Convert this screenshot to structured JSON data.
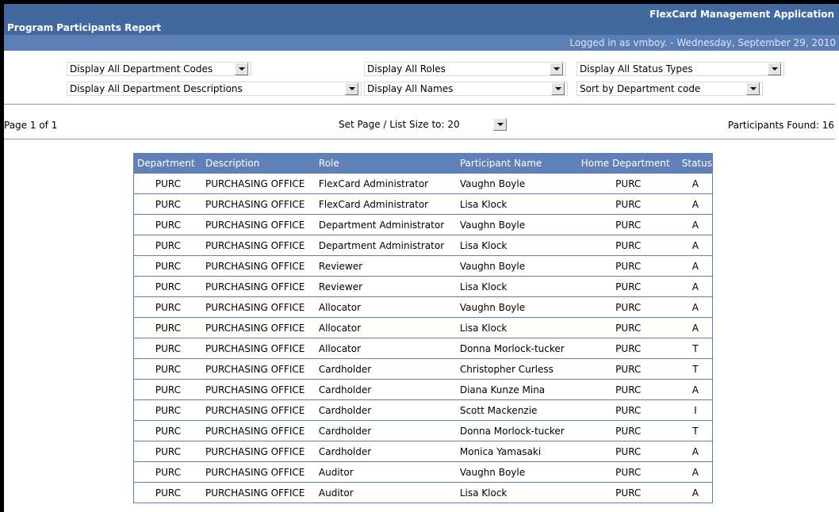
{
  "header": {
    "report_title": "Program Participants Report",
    "app_title": "FlexCard Management Application",
    "login_status": "Logged in as vmboy. - Wednesday, September 29, 2010"
  },
  "filters": {
    "dept_codes": "Display All Department Codes",
    "dept_descriptions": "Display All Department Descriptions",
    "roles": "Display All Roles",
    "names": "Display All Names",
    "status_types": "Display All Status Types",
    "sort": "Sort by Department code"
  },
  "pager": {
    "page_info": "Page 1 of 1",
    "page_size": "Set Page / List Size to: 20",
    "found": "Participants Found: 16"
  },
  "table": {
    "columns": [
      "Department",
      "Description",
      "Role",
      "Participant Name",
      "Home Department",
      "Status"
    ],
    "rows": [
      [
        "PURC",
        "PURCHASING OFFICE",
        "FlexCard Administrator",
        "Vaughn Boyle",
        "PURC",
        "A"
      ],
      [
        "PURC",
        "PURCHASING OFFICE",
        "FlexCard Administrator",
        "Lisa Klock",
        "PURC",
        "A"
      ],
      [
        "PURC",
        "PURCHASING OFFICE",
        "Department Administrator",
        "Vaughn Boyle",
        "PURC",
        "A"
      ],
      [
        "PURC",
        "PURCHASING OFFICE",
        "Department Administrator",
        "Lisa Klock",
        "PURC",
        "A"
      ],
      [
        "PURC",
        "PURCHASING OFFICE",
        "Reviewer",
        "Vaughn Boyle",
        "PURC",
        "A"
      ],
      [
        "PURC",
        "PURCHASING OFFICE",
        "Reviewer",
        "Lisa Klock",
        "PURC",
        "A"
      ],
      [
        "PURC",
        "PURCHASING OFFICE",
        "Allocator",
        "Vaughn Boyle",
        "PURC",
        "A"
      ],
      [
        "PURC",
        "PURCHASING OFFICE",
        "Allocator",
        "Lisa Klock",
        "PURC",
        "A"
      ],
      [
        "PURC",
        "PURCHASING OFFICE",
        "Allocator",
        "Donna Morlock-tucker",
        "PURC",
        "T"
      ],
      [
        "PURC",
        "PURCHASING OFFICE",
        "Cardholder",
        "Christopher Curless",
        "PURC",
        "T"
      ],
      [
        "PURC",
        "PURCHASING OFFICE",
        "Cardholder",
        "Diana Kunze Mina",
        "PURC",
        "A"
      ],
      [
        "PURC",
        "PURCHASING OFFICE",
        "Cardholder",
        "Scott Mackenzie",
        "PURC",
        "I"
      ],
      [
        "PURC",
        "PURCHASING OFFICE",
        "Cardholder",
        "Donna Morlock-tucker",
        "PURC",
        "T"
      ],
      [
        "PURC",
        "PURCHASING OFFICE",
        "Cardholder",
        "Monica Yamasaki",
        "PURC",
        "A"
      ],
      [
        "PURC",
        "PURCHASING OFFICE",
        "Auditor",
        "Vaughn Boyle",
        "PURC",
        "A"
      ],
      [
        "PURC",
        "PURCHASING OFFICE",
        "Auditor",
        "Lisa Klock",
        "PURC",
        "A"
      ]
    ]
  }
}
